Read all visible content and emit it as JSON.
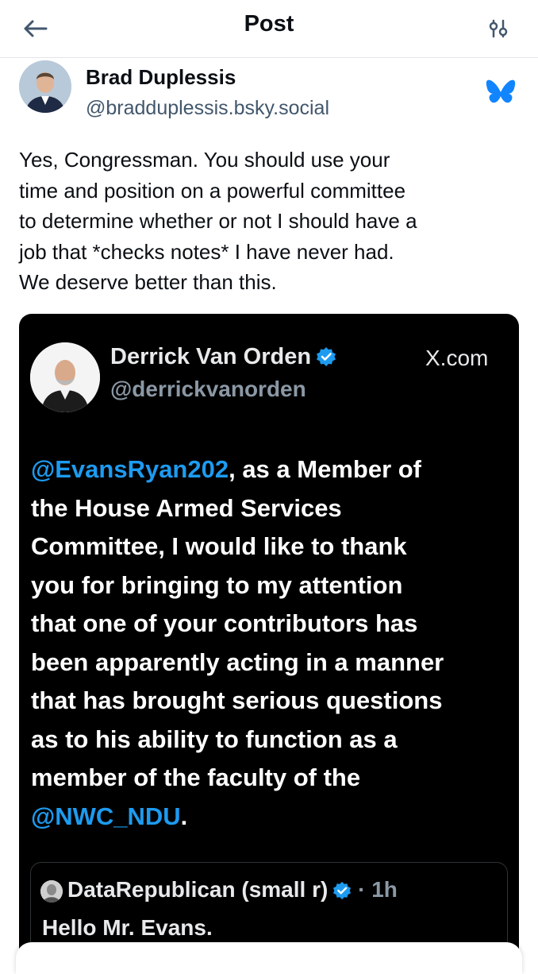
{
  "header": {
    "title": "Post",
    "back_icon": "arrow-left-icon",
    "settings_icon": "sliders-icon"
  },
  "author": {
    "name": "Brad Duplessis",
    "handle": "@bradduplessis.bsky.social",
    "platform_icon": "butterfly-icon"
  },
  "post": {
    "text": "Yes, Congressman. You should use your\ntime and position on a powerful committee\nto determine whether or not I should have a\njob that *checks notes* I have never had.\nWe deserve better than this."
  },
  "embed": {
    "author_name": "Derrick Van Orden",
    "author_handle": "@derrickvanorden",
    "source": "X.com",
    "mention_1": "@EvansRyan202",
    "text_after_mention": ", as a Member of\nthe House Armed Services\nCommittee, I would like to thank\nyou for bringing to my attention\nthat one of your contributors has\nbeen apparently acting in a manner\nthat has brought serious questions\nas to his ability to function as a\nmember of the faculty of the\n",
    "mention_2": "@NWC_NDU",
    "text_end": ".",
    "quoted": {
      "author_name": "DataRepublican (small r)",
      "time": "· 1h",
      "text": "Hello Mr. Evans."
    }
  },
  "colors": {
    "accent": "#1185fe",
    "link_blue": "#1d9bf0",
    "embed_background": "#000000",
    "handle_gray": "#42576c"
  }
}
